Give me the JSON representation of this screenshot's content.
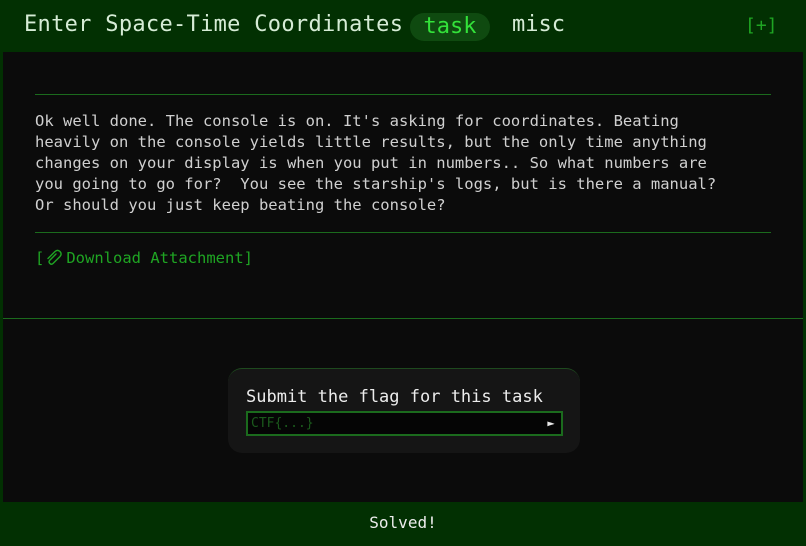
{
  "header": {
    "title": "Enter Space-Time Coordinates",
    "tags": [
      "task",
      "misc"
    ],
    "expand_label": "[+]"
  },
  "task": {
    "description": "Ok well done. The console is on. It's asking for coordinates. Beating\nheavily on the console yields little results, but the only time anything\nchanges on your display is when you put in numbers.. So what numbers are\nyou going to go for?  You see the starship's logs, but is there a manual?\nOr should you just keep beating the console?",
    "attachment_open": "[",
    "attachment_icon": "paperclip-icon",
    "attachment_label": "Download Attachment]"
  },
  "submit": {
    "label": "Submit the flag for this task",
    "placeholder": "CTF{...}",
    "value": "",
    "submit_icon": "play-arrow-icon"
  },
  "status": {
    "text": "Solved!"
  },
  "colors": {
    "accent": "#33e23a",
    "link": "#1fa523",
    "header_bg": "#023002",
    "panel_bg": "#0b0b0b",
    "rule": "#1b6b1d"
  }
}
